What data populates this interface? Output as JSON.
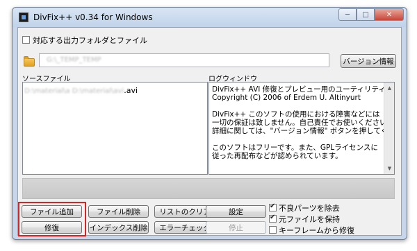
{
  "window": {
    "title": "DivFix++ v0.34  for Windows",
    "controls": {
      "minimize": "─",
      "maximize": "□",
      "close": "✕"
    }
  },
  "output": {
    "checkbox_label": "対応する出力フォルダとファイル",
    "checked": false,
    "path_value": "G:\\_TEMP_TEMP",
    "version_button": "バージョン情報"
  },
  "source": {
    "label": "ソースファイル",
    "file_prefix": "D:\\material\\a D:\\material\\avi",
    "file_ext": ".avi"
  },
  "log": {
    "label": "ログウィンドウ",
    "lines": [
      "DivFix++ AVI 修復とプレビュー用のユーティリティーです。",
      "Copyright (C) 2006 of Erdem U. Altinyurt",
      "",
      "DivFix++ このソフトの使用における障害などには",
      "一切の保証は致しません。自己責任でお使いください。",
      "詳細に関しては、\"バージョン情報\" ボタンを押してください。",
      "",
      "このソフトはフリーです。また、GPLライセンスに",
      "従った再配布などが認められています。"
    ]
  },
  "progress": {
    "value": 0
  },
  "buttons": {
    "add_file": "ファイル追加",
    "delete_file": "ファイル削除",
    "clear_list": "リストのクリア",
    "settings": "設定",
    "repair": "修復",
    "delete_index": "インデックス削除",
    "error_check": "エラーチェック",
    "stop": "停止"
  },
  "options": [
    {
      "label": "不良パーツを除去",
      "checked": true
    },
    {
      "label": "元ファイルを保持",
      "checked": true
    },
    {
      "label": "キーフレームから修復",
      "checked": false
    }
  ],
  "colors": {
    "highlight": "#d42424",
    "titlebar": "#c7d6e9"
  }
}
